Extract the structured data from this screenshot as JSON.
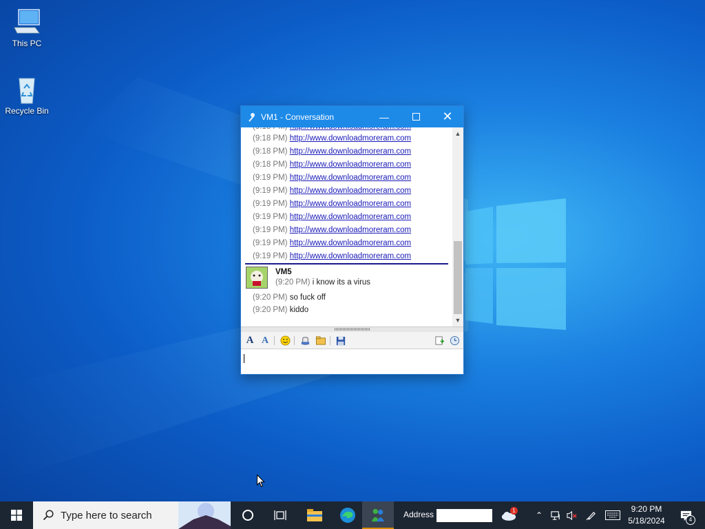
{
  "desktop": {
    "icons": [
      {
        "label": "This PC",
        "icon": "computer-icon"
      },
      {
        "label": "Recycle Bin",
        "icon": "recycle-bin-icon"
      }
    ]
  },
  "window": {
    "title": "VM1 - Conversation",
    "messages": [
      {
        "time": "(9:18 PM)",
        "text": "http://www.downloadmoreram.com"
      },
      {
        "time": "(9:18 PM)",
        "text": "http://www.downloadmoreram.com"
      },
      {
        "time": "(9:18 PM)",
        "text": "http://www.downloadmoreram.com"
      },
      {
        "time": "(9:19 PM)",
        "text": "http://www.downloadmoreram.com"
      },
      {
        "time": "(9:19 PM)",
        "text": "http://www.downloadmoreram.com"
      },
      {
        "time": "(9:19 PM)",
        "text": "http://www.downloadmoreram.com"
      },
      {
        "time": "(9:19 PM)",
        "text": "http://www.downloadmoreram.com"
      },
      {
        "time": "(9:19 PM)",
        "text": "http://www.downloadmoreram.com"
      },
      {
        "time": "(9:19 PM)",
        "text": "http://www.downloadmoreram.com"
      },
      {
        "time": "(9:19 PM)",
        "text": "http://www.downloadmoreram.com"
      }
    ],
    "reply": {
      "sender": "VM5",
      "lines": [
        {
          "time": "(9:20 PM)",
          "text": "i know its a virus"
        },
        {
          "time": "(9:20 PM)",
          "text": "so fuck off"
        },
        {
          "time": "(9:20 PM)",
          "text": "kiddo"
        }
      ]
    },
    "input_value": ""
  },
  "taskbar": {
    "search_placeholder": "Type here to search",
    "address_label": "Address",
    "address_value": "",
    "notification_badge": "1",
    "action_center_badge": "4",
    "clock": {
      "time": "9:20 PM",
      "date": "5/18/2024"
    }
  },
  "colors": {
    "taskbar_bg": "#1c2633",
    "titlebar_bg": "#1d8ae8",
    "link": "#1a1ab8",
    "separator": "#1a1a8c"
  }
}
